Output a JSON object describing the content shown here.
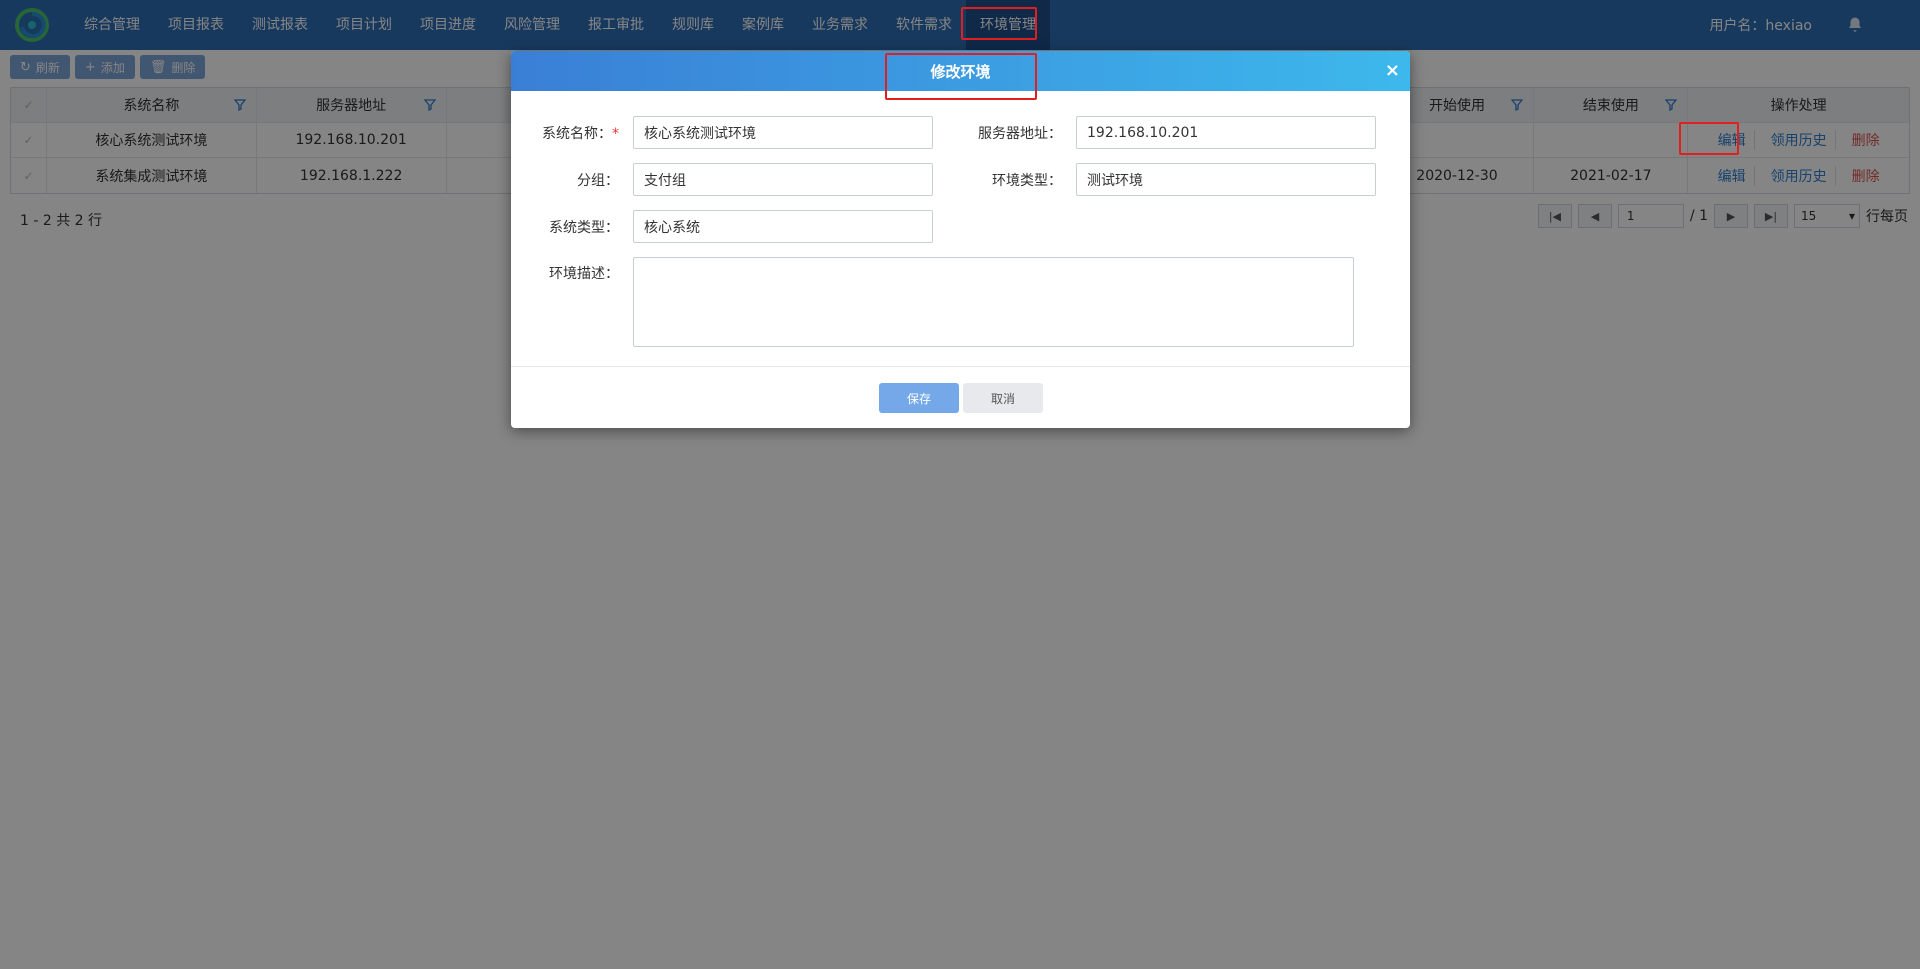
{
  "nav": {
    "items": [
      "综合管理",
      "项目报表",
      "测试报表",
      "项目计划",
      "项目进度",
      "风险管理",
      "报工审批",
      "规则库",
      "案例库",
      "业务需求",
      "软件需求",
      "环境管理"
    ],
    "active_index": 11,
    "user_label": "用户名：hexiao"
  },
  "toolbar": {
    "refresh": "刷新",
    "add": "添加",
    "delete": "删除"
  },
  "grid": {
    "headers": {
      "name": "系统名称",
      "addr": "服务器地址",
      "start": "开始使用",
      "end": "结束使用",
      "ops": "操作处理"
    },
    "rows": [
      {
        "name": "核心系统测试环境",
        "addr": "192.168.10.201",
        "start": "",
        "end": ""
      },
      {
        "name": "系统集成测试环境",
        "addr": "192.168.1.222",
        "start": "2020-12-30",
        "end": "2021-02-17"
      }
    ],
    "ops": {
      "edit": "编辑",
      "history": "领用历史",
      "delete": "删除"
    }
  },
  "pagination": {
    "row_info": "1 - 2 共 2 行",
    "page": "1",
    "total": "/ 1",
    "page_size": "15",
    "per_page_label": "行每页"
  },
  "modal": {
    "title": "修改环境",
    "close": "×",
    "fields": {
      "system_name": {
        "label": "系统名称：",
        "required_mark": "*",
        "value": "核心系统测试环境"
      },
      "server_addr": {
        "label": "服务器地址：",
        "value": "192.168.10.201"
      },
      "group": {
        "label": "分组：",
        "value": "支付组"
      },
      "env_type": {
        "label": "环境类型：",
        "value": "测试环境"
      },
      "system_type": {
        "label": "系统类型：",
        "value": "核心系统"
      },
      "env_desc": {
        "label": "环境描述：",
        "value": ""
      }
    },
    "save": "保存",
    "cancel": "取消"
  },
  "colors": {
    "nav_bg": "#2f6db5",
    "accent": "#2f7fd0",
    "danger": "#d9534f",
    "highlight": "#e02020"
  }
}
